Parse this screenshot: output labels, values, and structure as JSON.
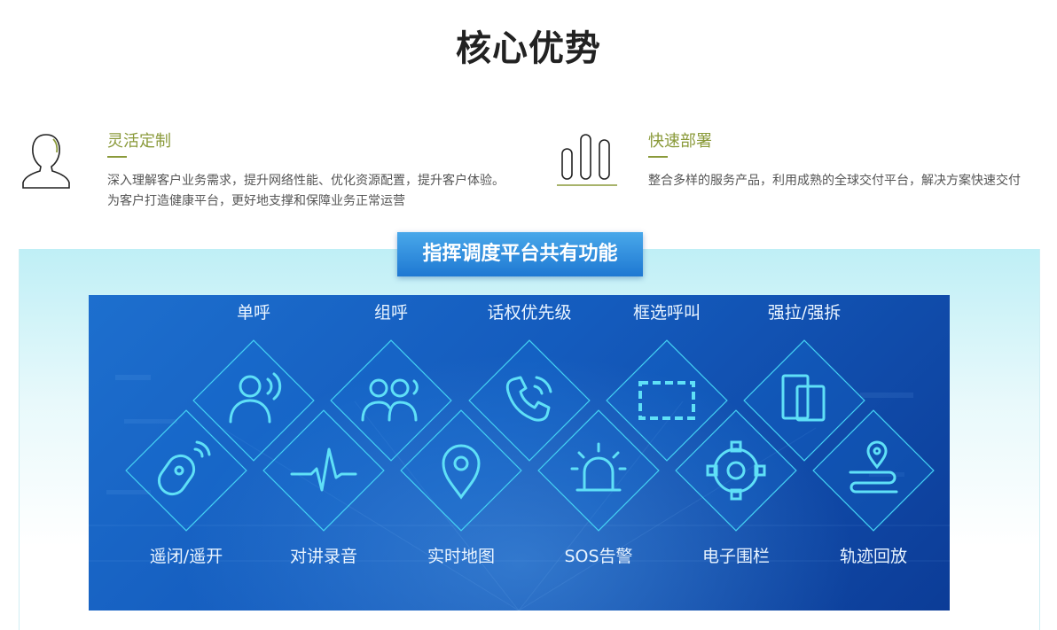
{
  "header": {
    "title": "核心优势"
  },
  "features": [
    {
      "icon": "user-icon",
      "title": "灵活定制",
      "desc": "深入理解客户业务需求，提升网络性能、优化资源配置，提升客户体验。为客户打造健康平台，更好地支撑和保障业务正常运营"
    },
    {
      "icon": "bar-chart-icon",
      "title": "快速部署",
      "desc": "整合多样的服务产品，利用成熟的全球交付平台，解决方案快速交付"
    }
  ],
  "platform": {
    "banner": "指挥调度平台共有功能",
    "top_items": [
      {
        "label": "单呼",
        "icon": "single-call-icon"
      },
      {
        "label": "组呼",
        "icon": "group-call-icon"
      },
      {
        "label": "话权优先级",
        "icon": "phone-priority-icon"
      },
      {
        "label": "框选呼叫",
        "icon": "box-select-icon"
      },
      {
        "label": "强拉/强拆",
        "icon": "force-pull-icon"
      }
    ],
    "bottom_items": [
      {
        "label": "遥闭/遥开",
        "icon": "remote-lock-icon"
      },
      {
        "label": "对讲录音",
        "icon": "voice-record-icon"
      },
      {
        "label": "实时地图",
        "icon": "map-pin-icon"
      },
      {
        "label": "SOS告警",
        "icon": "alarm-icon"
      },
      {
        "label": "电子围栏",
        "icon": "target-icon"
      },
      {
        "label": "轨迹回放",
        "icon": "route-icon"
      }
    ]
  },
  "colors": {
    "accent": "#8a9a3a",
    "banner": "#2a86dc",
    "stage": "#145bbd",
    "line": "#3fd3f5"
  }
}
